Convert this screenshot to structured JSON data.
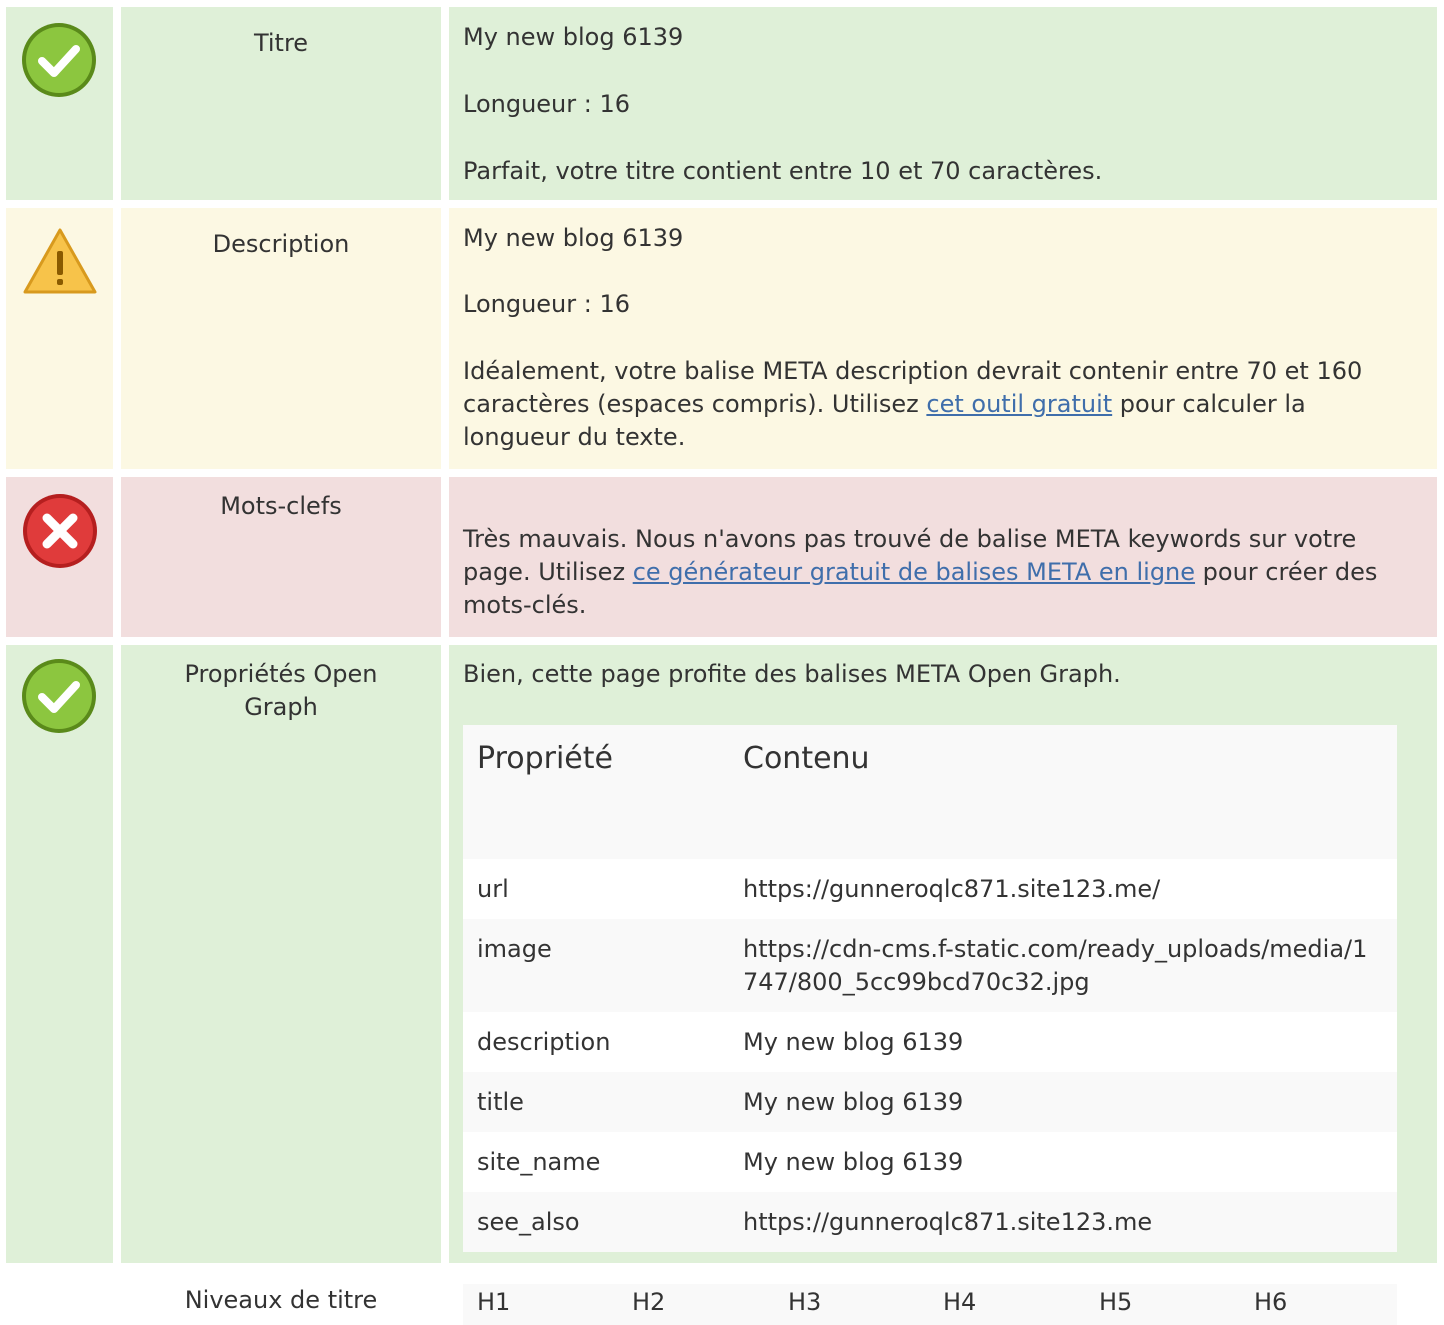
{
  "rows": {
    "title": {
      "status": "ok",
      "label": "Titre",
      "value": "My new blog 6139",
      "length": "Longueur : 16",
      "message": "Parfait, votre titre contient entre 10 et 70 caractères."
    },
    "description": {
      "status": "warning",
      "label": "Description",
      "value": "My new blog 6139",
      "length": "Longueur : 16",
      "message_before": "Idéalement, votre balise META description devrait contenir entre 70 et 160 caractères (espaces compris). Utilisez ",
      "link": "cet outil gratuit",
      "message_after": " pour calculer la longueur du texte."
    },
    "keywords": {
      "status": "error",
      "label": "Mots-clefs",
      "message_before": "Très mauvais. Nous n'avons pas trouvé de balise META keywords sur votre page. Utilisez ",
      "link": "ce générateur gratuit de balises META en ligne",
      "message_after": " pour créer des mots-clés."
    },
    "open_graph": {
      "status": "ok",
      "label": "Propriétés Open Graph",
      "message": "Bien, cette page profite des balises META Open Graph.",
      "table": {
        "headers": [
          "Propriété",
          "Contenu"
        ],
        "rows": [
          {
            "property": "url",
            "content": "https://gunneroqlc871.site123.me/"
          },
          {
            "property": "image",
            "content": "https://cdn-cms.f-static.com/ready_uploads/media/1747/800_5cc99bcd70c32.jpg"
          },
          {
            "property": "description",
            "content": "My new blog 6139"
          },
          {
            "property": "title",
            "content": "My new blog 6139"
          },
          {
            "property": "site_name",
            "content": "My new blog 6139"
          },
          {
            "property": "see_also",
            "content": "https://gunneroqlc871.site123.me"
          }
        ]
      }
    },
    "headings": {
      "label": "Niveaux de titre",
      "levels": [
        "H1",
        "H2",
        "H3",
        "H4",
        "H5",
        "H6"
      ]
    }
  },
  "colors": {
    "ok_bg": "#dff0d8",
    "warning_bg": "#fcf8e3",
    "error_bg": "#f2dede",
    "link": "#3f6eab"
  },
  "icons": {
    "ok": "check-circle-icon",
    "warning": "warning-triangle-icon",
    "error": "error-x-circle-icon"
  }
}
